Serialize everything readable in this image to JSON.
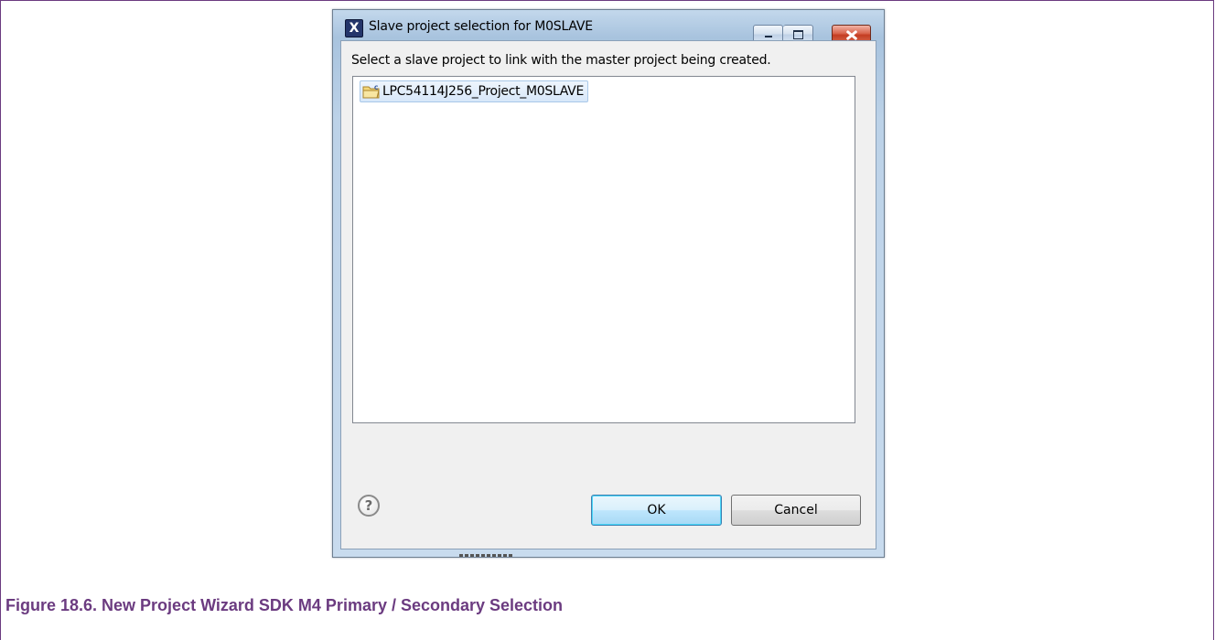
{
  "window": {
    "title": "Slave project selection for M0SLAVE",
    "app_icon_glyph": "X",
    "controls": [
      "minimize-icon",
      "maximize-icon",
      "close-icon"
    ]
  },
  "dialog": {
    "instruction": "Select a slave project to link with the master project being created.",
    "projects": [
      {
        "label": "LPC54114J256_Project_M0SLAVE",
        "icon": "project-folder-icon",
        "selected": true
      }
    ],
    "help_glyph": "?",
    "ok_label": "OK",
    "cancel_label": "Cancel"
  },
  "caption": "Figure 18.6. New Project Wizard SDK M4 Primary / Secondary Selection",
  "colors": {
    "caption": "#6b3b80",
    "selection_bg": "#d7e7f9",
    "default_button_border": "#3c7fb1"
  }
}
